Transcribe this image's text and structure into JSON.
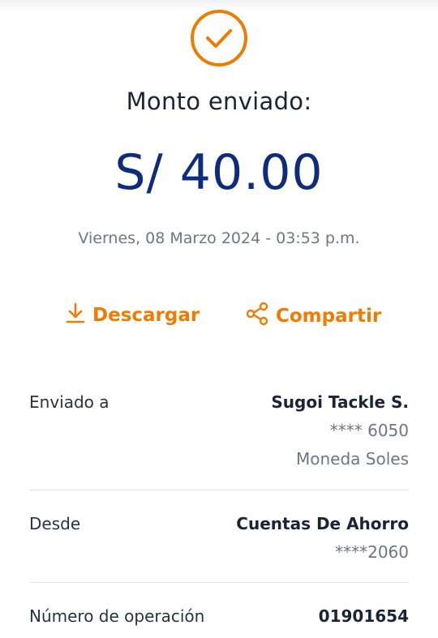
{
  "receipt": {
    "title": "Monto enviado:",
    "amount": "S/ 40.00",
    "datetime": "Viernes, 08 Marzo 2024 - 03:53 p.m."
  },
  "actions": {
    "download_label": "Descargar",
    "share_label": "Compartir"
  },
  "details": {
    "sent_to": {
      "label": "Enviado a",
      "name": "Sugoi Tackle S.",
      "account": "**** 6050",
      "currency": "Moneda Soles"
    },
    "from": {
      "label": "Desde",
      "account_type": "Cuentas De Ahorro",
      "account": "****2060"
    },
    "operation": {
      "label": "Número de operación",
      "number": "01901654"
    }
  },
  "colors": {
    "accent": "#f07b00",
    "amount": "#0e2c7e",
    "text": "#1b2436",
    "muted": "#6e7686"
  },
  "icons": {
    "status": "check-circle-icon",
    "download": "download-icon",
    "share": "share-icon"
  }
}
